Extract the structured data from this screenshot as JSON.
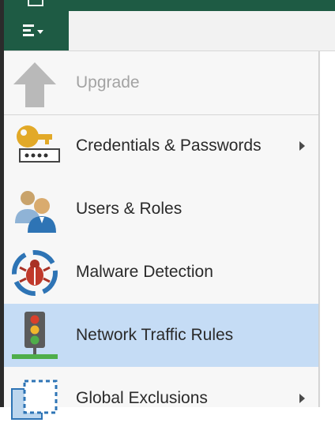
{
  "titlebar": {
    "color": "#1e5b44"
  },
  "menu_button": {
    "icon": "hamburger-menu-icon",
    "color": "#1e5b44"
  },
  "menu": {
    "items": [
      {
        "label": "Upgrade",
        "icon": "upgrade-arrow-icon",
        "disabled": true
      },
      {
        "label": "Credentials & Passwords",
        "icon": "key-password-icon",
        "submenu": true
      },
      {
        "label": "Users & Roles",
        "icon": "users-icon"
      },
      {
        "label": "Malware Detection",
        "icon": "bug-target-icon"
      },
      {
        "label": "Network Traffic Rules",
        "icon": "traffic-light-icon",
        "highlighted": true
      },
      {
        "label": "Global Exclusions",
        "icon": "exclusions-icon",
        "submenu": true
      }
    ],
    "highlight_color": "#c5dcf5"
  }
}
